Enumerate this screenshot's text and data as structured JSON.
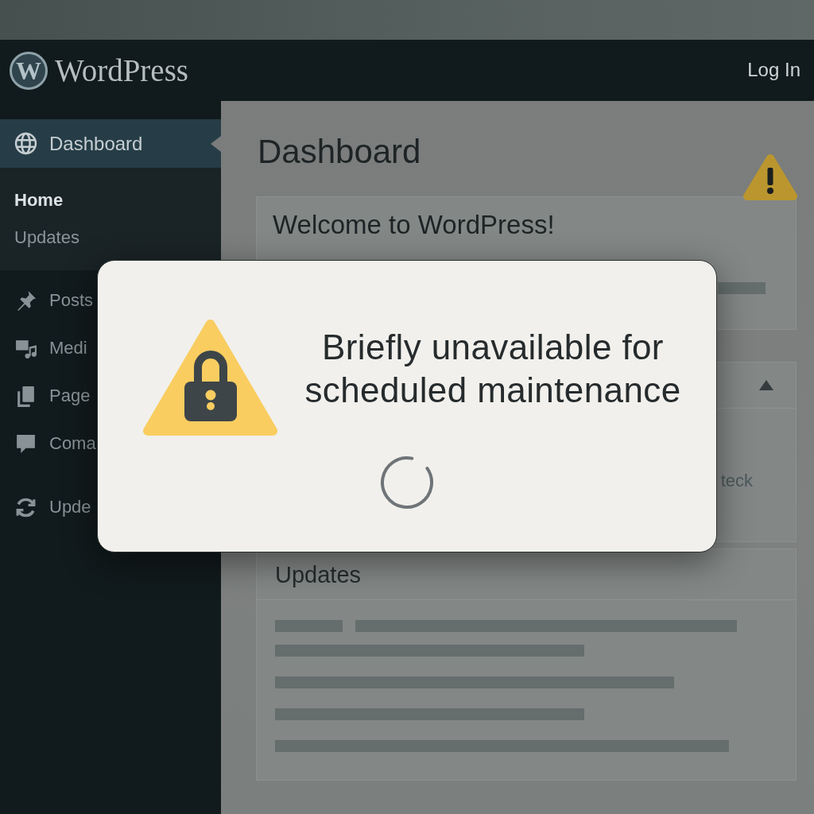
{
  "admin_bar": {
    "logo_mark": "W",
    "site_name": "WordPress",
    "login_link": "Log In"
  },
  "sidebar": {
    "groups": [
      {
        "items": [
          {
            "label": "Dashboard",
            "selected": true,
            "submenu": [
              {
                "label": "Home",
                "selected": true
              },
              {
                "label": "Updates",
                "selected": false
              }
            ]
          }
        ]
      },
      {
        "items": [
          {
            "label": "Posts",
            "selected": false
          },
          {
            "label": "Medi",
            "selected": false
          },
          {
            "label": "Page",
            "selected": false
          },
          {
            "label": "Coma",
            "selected": false
          }
        ]
      },
      {
        "items": [
          {
            "label": "Upde",
            "selected": false
          }
        ]
      }
    ]
  },
  "main": {
    "title": "Dashboard",
    "panels": [
      {
        "kind": "welcome",
        "title": "Welcome to WordPress!"
      },
      {
        "kind": "toggle",
        "expanded": true,
        "text": "teck"
      },
      {
        "kind": "updates",
        "title": "Updates"
      }
    ]
  },
  "dialog": {
    "title": "Briefly unavailable for scheduled maintenance",
    "loading": true
  }
}
